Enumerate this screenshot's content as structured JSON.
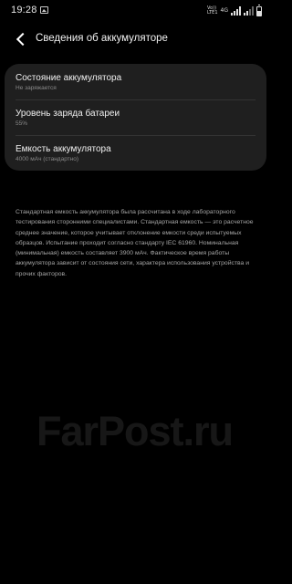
{
  "status_bar": {
    "time": "19:28",
    "volte_line1": "Vo))",
    "volte_line2": "LTE1",
    "network": "4G",
    "battery_level": 0.55
  },
  "header": {
    "title": "Сведения об аккумуляторе"
  },
  "items": [
    {
      "title": "Состояние аккумулятора",
      "subtitle": "Не заряжается"
    },
    {
      "title": "Уровень заряда батареи",
      "subtitle": "55%"
    },
    {
      "title": "Емкость аккумулятора",
      "subtitle": "4000 мАч (стандартно)"
    }
  ],
  "description": "Стандартная емкость аккумулятора была рассчитана в ходе лабораторного тестирования сторонними специалистами. Стандартная емкость — это расчетное среднее значение, которое учитывает отклонение емкости среди испытуемых образцов. Испытание проходит согласно стандарту IEC 61960. Номинальная (минимальная) емкость составляет 3900 мАч. Фактическое время работы аккумулятора зависит от состояния сети, характера использования устройства и прочих факторов.",
  "watermark": "FarPost.ru"
}
